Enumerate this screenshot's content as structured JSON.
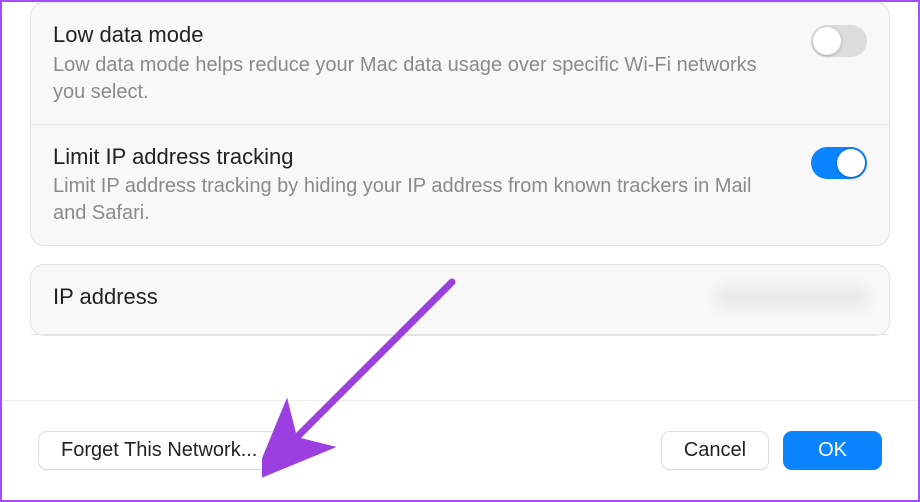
{
  "settings": [
    {
      "title": "Low data mode",
      "desc": "Low data mode helps reduce your Mac data usage over specific Wi-Fi networks you select.",
      "on": false
    },
    {
      "title": "Limit IP address tracking",
      "desc": "Limit IP address tracking by hiding your IP address from known trackers in Mail and Safari.",
      "on": true
    }
  ],
  "ip_section": {
    "label": "IP address"
  },
  "footer": {
    "forget": "Forget This Network...",
    "cancel": "Cancel",
    "ok": "OK"
  },
  "colors": {
    "accent": "#0a84ff",
    "annotation": "#9b3fe0"
  }
}
